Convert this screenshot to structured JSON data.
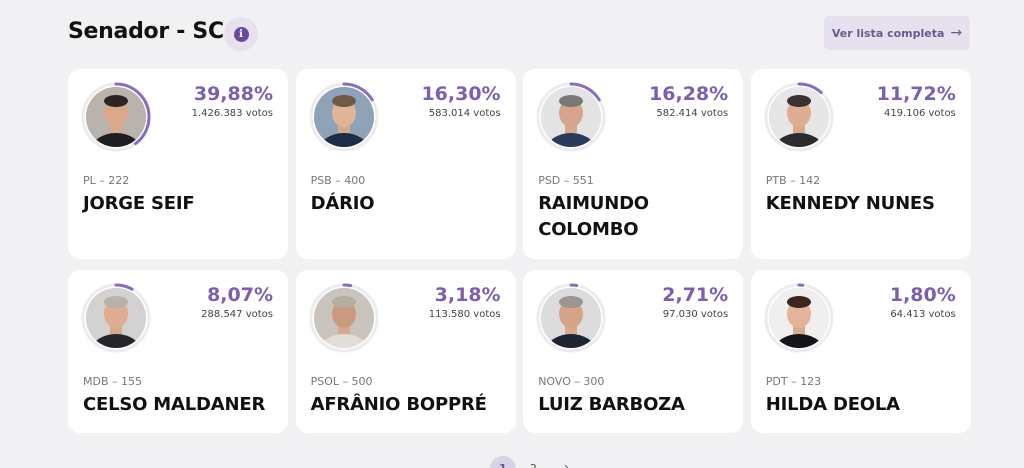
{
  "header": {
    "title": "Senador - SC",
    "info_icon": "info-icon",
    "full_list_label": "Ver lista completa",
    "full_list_icon": "arrow-right-icon"
  },
  "colors": {
    "accent": "#7c5fae",
    "ring_track": "#ececee",
    "background": "#f1f0f2"
  },
  "candidates": [
    {
      "percent": "39,88%",
      "percent_value": 39.88,
      "votes": "1.426.383 votos",
      "party": "PL – 222",
      "name": "JORGE SEIF"
    },
    {
      "percent": "16,30%",
      "percent_value": 16.3,
      "votes": "583.014 votos",
      "party": "PSB – 400",
      "name": "DÁRIO"
    },
    {
      "percent": "16,28%",
      "percent_value": 16.28,
      "votes": "582.414 votos",
      "party": "PSD – 551",
      "name": "RAIMUNDO COLOMBO"
    },
    {
      "percent": "11,72%",
      "percent_value": 11.72,
      "votes": "419.106 votos",
      "party": "PTB – 142",
      "name": "KENNEDY NUNES"
    },
    {
      "percent": "8,07%",
      "percent_value": 8.07,
      "votes": "288.547 votos",
      "party": "MDB – 155",
      "name": "CELSO MALDANER"
    },
    {
      "percent": "3,18%",
      "percent_value": 3.18,
      "votes": "113.580 votos",
      "party": "PSOL – 500",
      "name": "AFRÂNIO BOPPRÉ"
    },
    {
      "percent": "2,71%",
      "percent_value": 2.71,
      "votes": "97.030 votos",
      "party": "NOVO – 300",
      "name": "LUIZ BARBOZA"
    },
    {
      "percent": "1,80%",
      "percent_value": 1.8,
      "votes": "64.413 votos",
      "party": "PDT – 123",
      "name": "HILDA DEOLA"
    }
  ],
  "pagination": {
    "page_1": "1",
    "page_2": "2",
    "next_icon": "chevron-right-icon"
  }
}
